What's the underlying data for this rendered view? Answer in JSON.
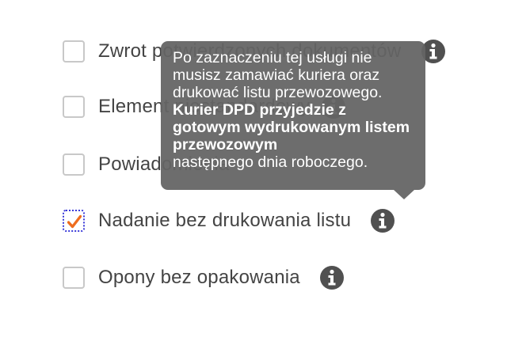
{
  "options": [
    {
      "label": "Zwrot potwierdzonych dokumentów",
      "checked": false,
      "info_icon": "info-circle-icon"
    },
    {
      "label": "Element niestandardowy",
      "checked": false,
      "info_icon": "info-circle-icon"
    },
    {
      "label": "Powiadomienia",
      "checked": false,
      "info_icon": null
    },
    {
      "label": "Nadanie bez drukowania listu",
      "checked": true,
      "info_icon": "info-circle-icon"
    },
    {
      "label": "Opony bez opakowania",
      "checked": false,
      "info_icon": "info-circle-icon"
    }
  ],
  "tooltip": {
    "text": "Po zaznaczeniu tej usługi nie musisz zamawiać kuriera oraz drukować listu przewozowego.",
    "bold_text": "Kurier DPD przyjedzie z gotowym wydrukowanym listem przewozowym",
    "tail_text": "następnego dnia roboczego."
  },
  "colors": {
    "checkmark": "#ee6d1e",
    "checkbox_border": "#c8c8c8",
    "focus_border": "#3b3bd9",
    "label_text": "#444444",
    "info_icon": "#505050",
    "tooltip_bg": "#646464"
  }
}
